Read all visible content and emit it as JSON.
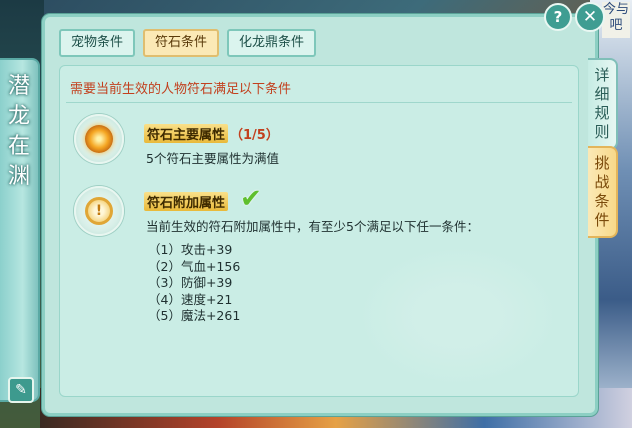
{
  "left_banner": {
    "title": "潜龙在渊"
  },
  "tabs": [
    {
      "label": "宠物条件",
      "active": false
    },
    {
      "label": "符石条件",
      "active": true
    },
    {
      "label": "化龙鼎条件",
      "active": false
    }
  ],
  "header": {
    "requirement": "需要当前生效的人物符石满足以下条件"
  },
  "conditions": {
    "main": {
      "title": "符石主要属性",
      "count": "（1/5）",
      "description": "5个符石主要属性为满值"
    },
    "extra": {
      "title": "符石附加属性",
      "description": "当前生效的符石附加属性中，有至少5个满足以下任一条件：",
      "items": [
        "（1）攻击+39",
        "（2）气血+156",
        "（3）防御+39",
        "（4）速度+21",
        "（5）魔法+261"
      ]
    }
  },
  "right_tabs": [
    {
      "label": "详细规则"
    },
    {
      "label": "挑战条件"
    }
  ],
  "buttons": {
    "help": "?",
    "close": "✕"
  },
  "background_text": "今与吧"
}
